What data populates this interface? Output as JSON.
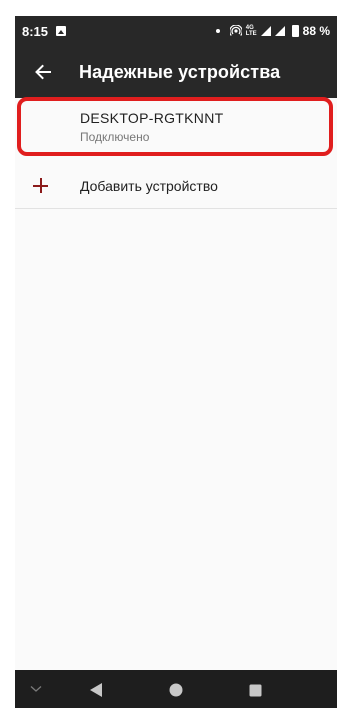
{
  "status_bar": {
    "time": "8:15",
    "lte_top": "4G",
    "lte_bottom": "LTE",
    "battery_pct": "88 %"
  },
  "app_bar": {
    "title": "Надежные устройства"
  },
  "device": {
    "name": "DESKTOP-RGTKNNT",
    "status": "Подключено"
  },
  "add_device": {
    "label": "Добавить устройство"
  },
  "colors": {
    "bar": "#282828",
    "highlight": "#e01e1e",
    "accent_plus": "#8b1a1a"
  },
  "icons": [
    "image-icon",
    "hotspot-icon",
    "signal-icon",
    "battery-icon",
    "back-arrow-icon",
    "plus-icon",
    "chevron-down-icon",
    "nav-back-icon",
    "nav-home-icon",
    "nav-recents-icon"
  ]
}
